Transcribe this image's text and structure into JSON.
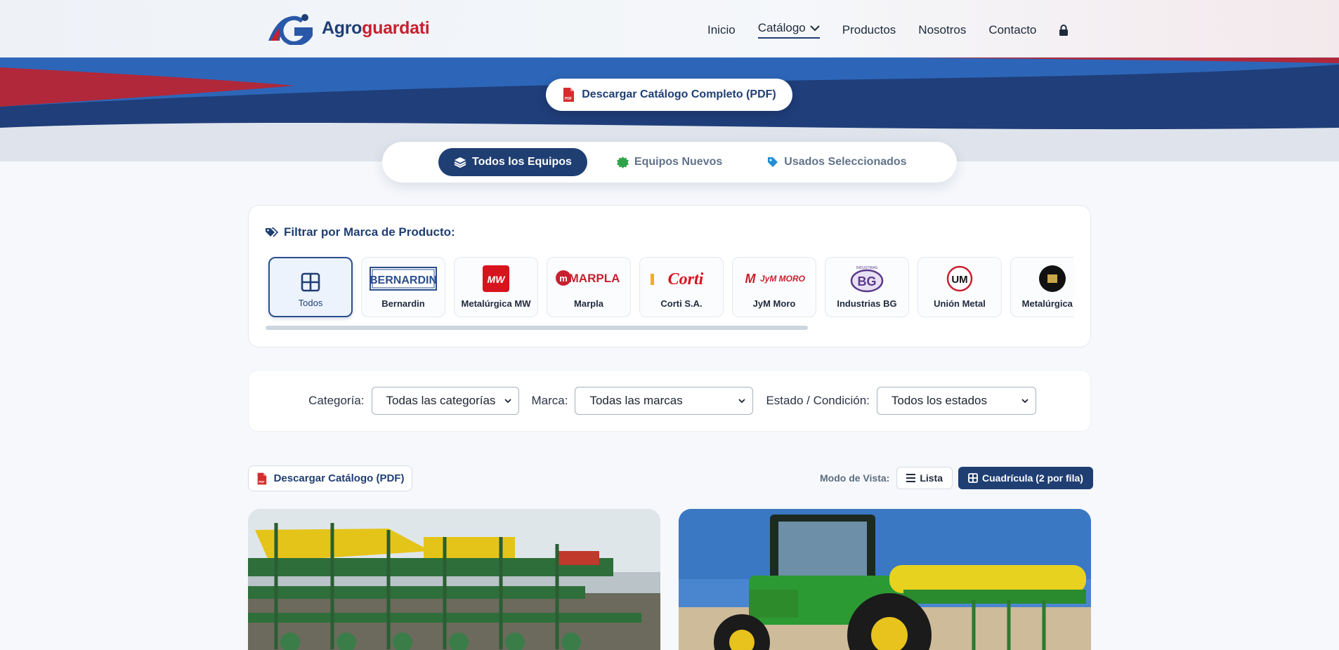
{
  "header": {
    "brand_part1": "Agro",
    "brand_part2": "guardati",
    "nav": [
      "Inicio",
      "Catálogo",
      "Productos",
      "Nosotros",
      "Contacto"
    ]
  },
  "hero": {
    "download_full_label": "Descargar Catálogo Completo (PDF)"
  },
  "tabs": [
    {
      "label": "Todos los Equipos",
      "icon": "layers-icon",
      "active": true
    },
    {
      "label": "Equipos Nuevos",
      "icon": "badge-icon",
      "active": false
    },
    {
      "label": "Usados Seleccionados",
      "icon": "tag-icon",
      "active": false
    }
  ],
  "brand_filter": {
    "title": "Filtrar por Marca de Producto:",
    "brands": [
      "Todos",
      "Bernardin",
      "Metalúrgica MW",
      "Marpla",
      "Corti S.A.",
      "JyM Moro",
      "Industrias BG",
      "Unión Metal",
      "Metalúrgica M"
    ],
    "logo_texts": {
      "bernardin": "BERNARDIN",
      "mw": "MW",
      "marpla": "MARPLA",
      "corti": "Corti",
      "jym": "JyM MORO",
      "bg": "BG",
      "bg_top": "INDUSTRIAS",
      "um": "UM"
    }
  },
  "filters": {
    "category_label": "Categoría:",
    "category_value": "Todas las categorías",
    "brand_label": "Marca:",
    "brand_value": "Todas las marcas",
    "status_label": "Estado / Condición:",
    "status_value": "Todos los estados"
  },
  "toolbar": {
    "download_label": "Descargar Catálogo (PDF)",
    "view_mode_label": "Modo de Vista:",
    "list_label": "Lista",
    "grid_label": "Cuadrícula (2 por fila)"
  },
  "colors": {
    "primary": "#1f3f73",
    "accent_red": "#c8202f",
    "green": "#2fa34a"
  }
}
